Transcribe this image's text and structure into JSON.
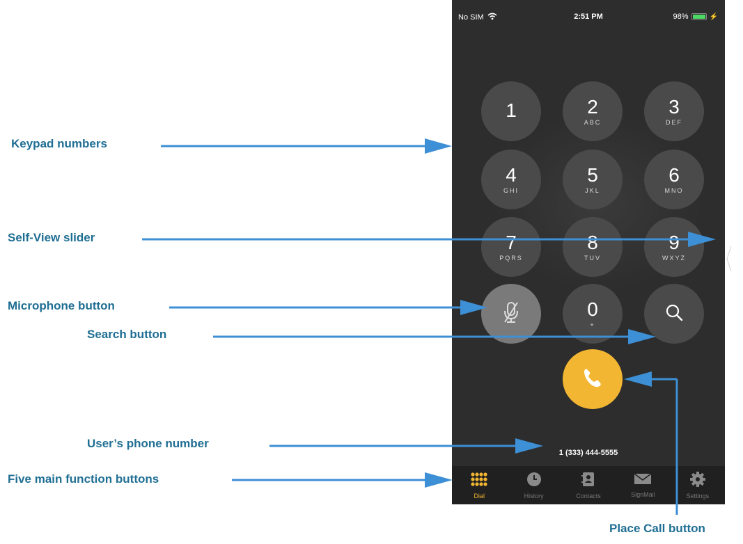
{
  "status_bar": {
    "carrier": "No SIM",
    "time": "2:51 PM",
    "battery": "98%"
  },
  "keypad": [
    {
      "num": "1",
      "letters": ""
    },
    {
      "num": "2",
      "letters": "ABC"
    },
    {
      "num": "3",
      "letters": "DEF"
    },
    {
      "num": "4",
      "letters": "GHI"
    },
    {
      "num": "5",
      "letters": "JKL"
    },
    {
      "num": "6",
      "letters": "MNO"
    },
    {
      "num": "7",
      "letters": "PQRS"
    },
    {
      "num": "8",
      "letters": "TUV"
    },
    {
      "num": "9",
      "letters": "WXYZ"
    },
    {
      "num": "0",
      "letters": "+"
    }
  ],
  "user_phone_number": "1 (333) 444-5555",
  "tabs": [
    {
      "label": "Dial",
      "icon": "dial-grid-icon",
      "active": true
    },
    {
      "label": "History",
      "icon": "clock-icon",
      "active": false
    },
    {
      "label": "Contacts",
      "icon": "contacts-book-icon",
      "active": false
    },
    {
      "label": "SignMail",
      "icon": "envelope-icon",
      "active": false
    },
    {
      "label": "Settings",
      "icon": "gear-icon",
      "active": false
    }
  ],
  "annotations": {
    "keypad_numbers": "Keypad numbers",
    "self_view_slider": "Self-View slider",
    "microphone_button": "Microphone button",
    "search_button": "Search button",
    "users_phone_number": "User’s phone number",
    "five_main_function_buttons": "Five main function buttons",
    "place_call_button": "Place Call button"
  },
  "colors": {
    "accent": "#f2b632",
    "annotation_text": "#1f6e93",
    "arrow": "#3d8fd6",
    "phone_background": "#2d2d2d",
    "key_background": "#4a4a4a"
  }
}
